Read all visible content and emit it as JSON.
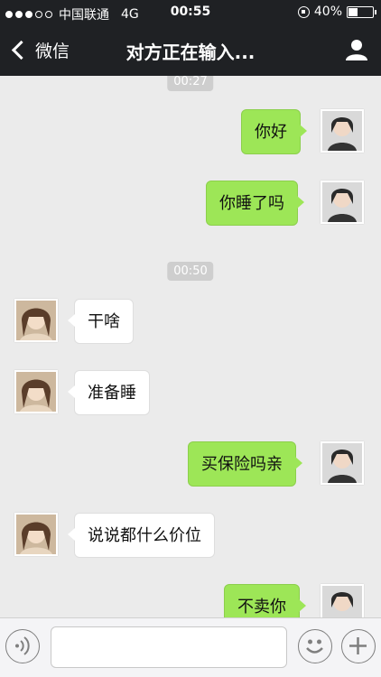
{
  "status_bar": {
    "carrier": "中国联通",
    "network": "4G",
    "time": "00:55",
    "battery_text": "40%",
    "battery_level": 0.4,
    "signal_bars_filled": 3,
    "signal_bars_total": 5
  },
  "nav": {
    "back_label": "微信",
    "title": "对方正在输入...",
    "back_icon": "chevron-left-icon",
    "profile_icon": "person-icon"
  },
  "messages": {
    "ts1": "00:27",
    "m1": "你好",
    "m2": "你睡了吗",
    "ts2": "00:50",
    "m3": "干啥",
    "m4": "准备睡",
    "m5": "买保险吗亲",
    "m6": "说说都什么价位",
    "m7": "不卖你"
  },
  "input": {
    "value": "",
    "voice_icon": "voice-icon",
    "emoji_icon": "emoji-icon",
    "plus_icon": "plus-icon"
  },
  "colors": {
    "bar": "#1f2124",
    "outgoing_bubble": "#9de657",
    "incoming_bubble": "#ffffff",
    "background": "#ebebeb"
  }
}
